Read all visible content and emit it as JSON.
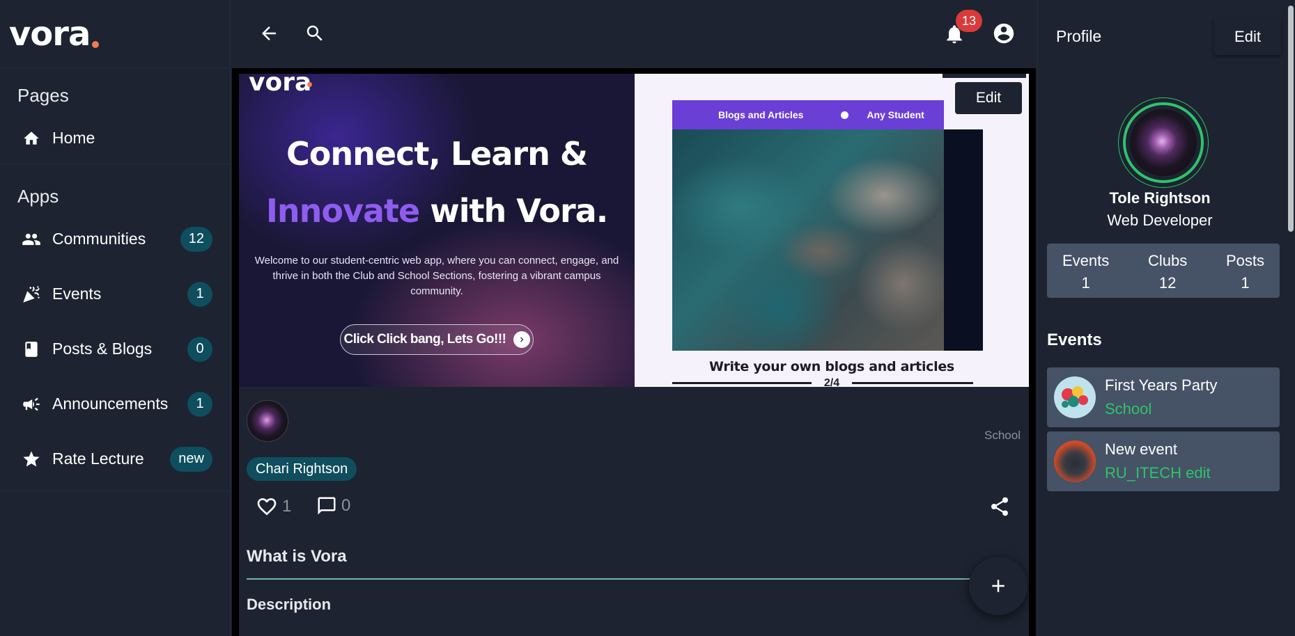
{
  "app": {
    "logo": "vora"
  },
  "sidebar": {
    "pages_title": "Pages",
    "apps_title": "Apps",
    "home": {
      "label": "Home",
      "icon": "home-icon"
    },
    "items": [
      {
        "label": "Communities",
        "badge": "12",
        "icon": "people-icon"
      },
      {
        "label": "Events",
        "badge": "1",
        "icon": "party-popper-icon"
      },
      {
        "label": "Posts & Blogs",
        "badge": "0",
        "icon": "book-icon"
      },
      {
        "label": "Announcements",
        "badge": "1",
        "icon": "megaphone-icon"
      },
      {
        "label": "Rate Lecture",
        "badge": "new",
        "icon": "star-icon"
      }
    ]
  },
  "header": {
    "notification_count": "13"
  },
  "post": {
    "banner": {
      "logo": "vora",
      "headline_line1": "Connect, Learn &",
      "headline_accent": "Innovate",
      "headline_line2_rest": " with Vora.",
      "welcome_text": "Welcome to our student-centric web app, where you can connect, engage, and thrive in both the Club and School Sections, fostering a vibrant campus community.",
      "cta_label": "Click Click bang, Lets Go!!!",
      "slide_tab_1": "Blogs and Articles",
      "slide_tab_2": "Any Student",
      "slide_caption": "Write your own blogs and articles",
      "slide_counter": "2/4",
      "edit_label": "Edit"
    },
    "tag": "School",
    "author": "Chari Rightson",
    "likes": "1",
    "comments": "0",
    "title": "What is Vora",
    "description_label": "Description"
  },
  "profile": {
    "title": "Profile",
    "edit_label": "Edit",
    "name": "Tole Rightson",
    "role": "Web Developer",
    "stats": [
      {
        "label": "Events",
        "value": "1"
      },
      {
        "label": "Clubs",
        "value": "12"
      },
      {
        "label": "Posts",
        "value": "1"
      }
    ],
    "events_title": "Events",
    "events": [
      {
        "title": "First Years Party",
        "subtitle": "School"
      },
      {
        "title": "New event",
        "subtitle": "RU_ITECH edit"
      }
    ]
  },
  "colors": {
    "background": "#1d2330",
    "badge": "#0f4e5e",
    "accent_green": "#2ec46a",
    "notification_red": "#d93a3a",
    "card": "#465266",
    "brand_dot": "#f07b4d",
    "banner_accent": "#8f5cf0"
  }
}
